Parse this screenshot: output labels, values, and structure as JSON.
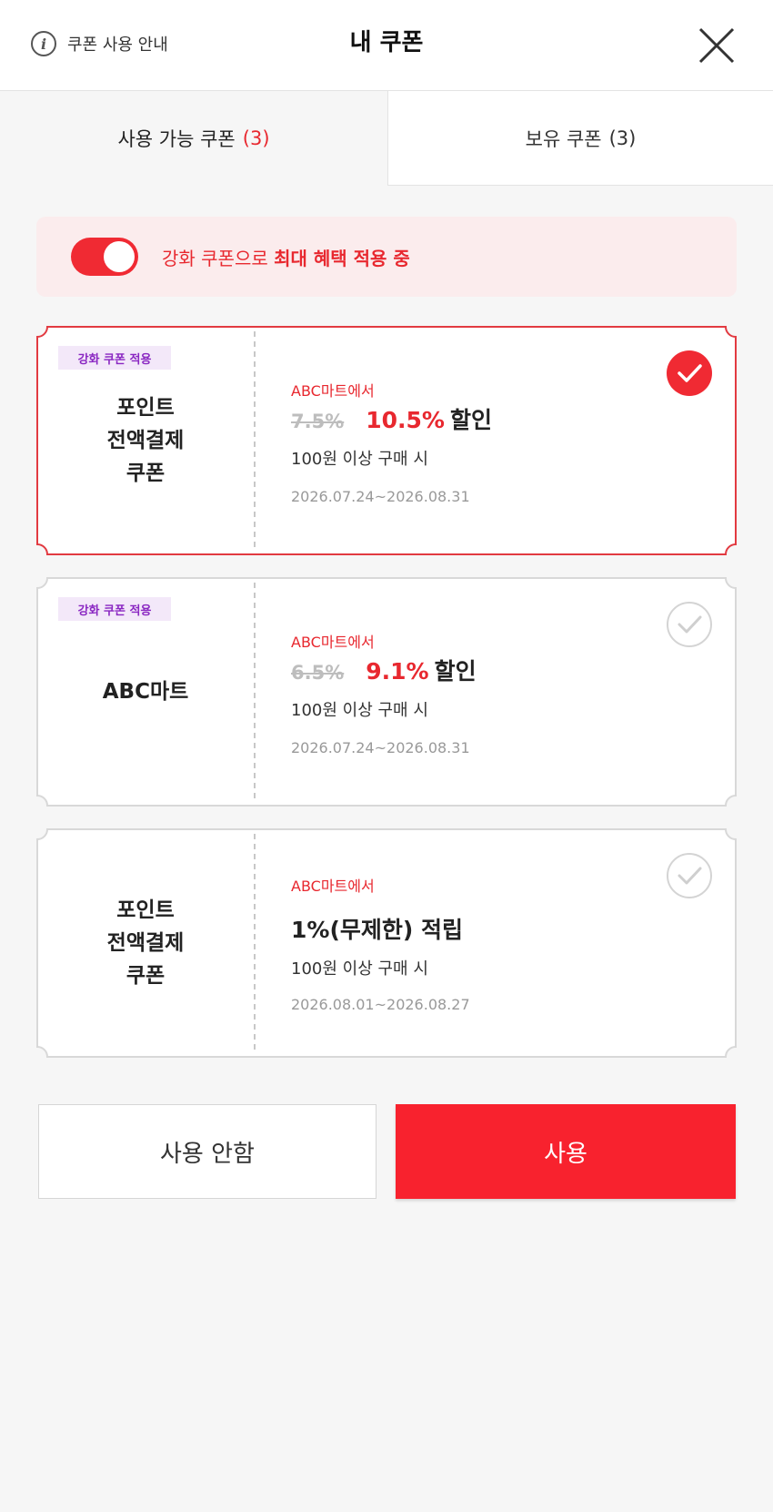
{
  "header": {
    "guide_label": "쿠폰 사용 안내",
    "title": "내 쿠폰"
  },
  "tabs": [
    {
      "label": "사용 가능 쿠폰",
      "count": "(3)",
      "active": true
    },
    {
      "label": "보유 쿠폰",
      "count": "(3)",
      "active": false
    }
  ],
  "banner": {
    "text_prefix": "강화 쿠폰으로 ",
    "text_bold": "최대 혜택 적용 중",
    "toggle_on": true
  },
  "coupons": [
    {
      "badge": "강화 쿠폰 적용",
      "name": "포인트\n전액결제\n쿠폰",
      "store": "ABC마트에서",
      "old_rate": "7.5%",
      "new_rate": "10.5%",
      "benefit": "할인",
      "condition": "100원 이상 구매 시",
      "period": "2026.07.24~2026.08.31",
      "selected": true
    },
    {
      "badge": "강화 쿠폰 적용",
      "name": "ABC마트",
      "store": "ABC마트에서",
      "old_rate": "6.5%",
      "new_rate": "9.1%",
      "benefit": "할인",
      "condition": "100원 이상 구매 시",
      "period": "2026.07.24~2026.08.31",
      "selected": false
    },
    {
      "name": "포인트\n전액결제\n쿠폰",
      "store": "ABC마트에서",
      "benefit": "1%(무제한) 적립",
      "condition": "100원 이상 구매 시",
      "period": "2026.08.01~2026.08.27",
      "selected": false
    }
  ],
  "actions": {
    "cancel_label": "사용 안함",
    "use_label": "사용"
  },
  "colors": {
    "accent": "#f8222e",
    "badge_bg": "#f3e8f9",
    "badge_text": "#8a27c2",
    "banner_bg": "#fbeced"
  }
}
